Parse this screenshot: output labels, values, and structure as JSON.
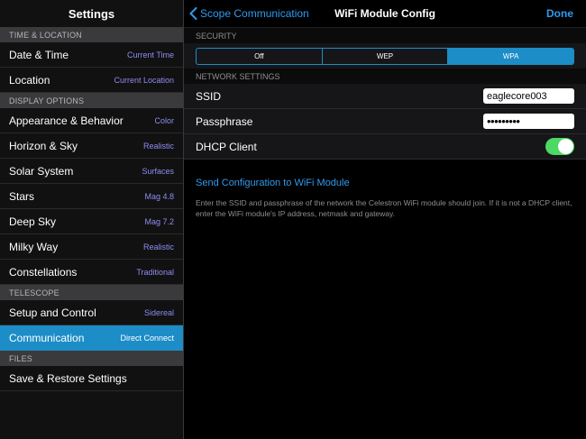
{
  "sidebar": {
    "title": "Settings",
    "sections": [
      {
        "header": "TIME & LOCATION",
        "rows": [
          {
            "label": "Date & Time",
            "value": "Current Time"
          },
          {
            "label": "Location",
            "value": "Current Location"
          }
        ]
      },
      {
        "header": "DISPLAY OPTIONS",
        "rows": [
          {
            "label": "Appearance & Behavior",
            "value": "Color"
          },
          {
            "label": "Horizon & Sky",
            "value": "Realistic"
          },
          {
            "label": "Solar System",
            "value": "Surfaces"
          },
          {
            "label": "Stars",
            "value": "Mag 4.8"
          },
          {
            "label": "Deep Sky",
            "value": "Mag 7.2"
          },
          {
            "label": "Milky Way",
            "value": "Realistic"
          },
          {
            "label": "Constellations",
            "value": "Traditional"
          }
        ]
      },
      {
        "header": "TELESCOPE",
        "rows": [
          {
            "label": "Setup and Control",
            "value": "Sidereal"
          },
          {
            "label": "Communication",
            "value": "Direct Connect"
          }
        ]
      },
      {
        "header": "FILES",
        "rows": [
          {
            "label": "Save & Restore Settings",
            "value": ""
          }
        ]
      }
    ]
  },
  "navbar": {
    "back_label": "Scope Communication",
    "title": "WiFi Module Config",
    "done_label": "Done"
  },
  "security": {
    "header": "SECURITY",
    "options": [
      "Off",
      "WEP",
      "WPA"
    ],
    "selected": "WPA"
  },
  "network": {
    "header": "NETWORK SETTINGS",
    "ssid_label": "SSID",
    "ssid_value": "eaglecore003",
    "passphrase_label": "Passphrase",
    "passphrase_value": "•••••••••",
    "dhcp_label": "DHCP Client",
    "dhcp_on": true
  },
  "send_label": "Send Configuration to WiFi Module",
  "help_text": "Enter the SSID and passphrase of the network the Celestron WiFi module should join.  If it is not a DHCP client, enter the WiFi module's IP address, netmask and gateway.",
  "colors": {
    "accent": "#1c8dc7",
    "link": "#2e9bf0",
    "sidebar_value": "#8f8cf2",
    "toggle_on": "#4cd964"
  }
}
